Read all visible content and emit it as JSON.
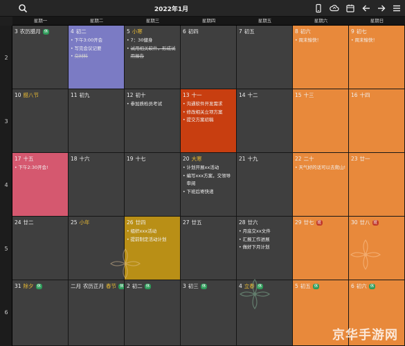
{
  "toolbar": {
    "title": "2022年1月",
    "icons": [
      "search-icon",
      "phone-icon",
      "cloud-sync-icon",
      "calendar-icon",
      "back-arrow-icon",
      "forward-arrow-icon",
      "menu-icon"
    ]
  },
  "weekdays": [
    "星期一",
    "星期二",
    "星期三",
    "星期四",
    "星期五",
    "星期六",
    "星期日"
  ],
  "week_numbers": [
    "2",
    "3",
    "4",
    "5",
    "6"
  ],
  "weeks": [
    [
      {
        "day": "3",
        "lunar": "农历腊月",
        "badge": "休",
        "badge_type": "work",
        "color": "dim",
        "events": []
      },
      {
        "day": "4",
        "lunar": "初二",
        "color": "purple",
        "events": [
          {
            "text": "下午3:00开会",
            "done": false
          },
          {
            "text": "写完会议记要",
            "done": false
          },
          {
            "text": "交材料",
            "done": true
          }
        ]
      },
      {
        "day": "5",
        "lunar": "小寒",
        "term": true,
        "color": "dim",
        "events": [
          {
            "text": "7：30健身",
            "done": false
          },
          {
            "text": "试用相关软件，形成试用报告",
            "done": true
          }
        ]
      },
      {
        "day": "6",
        "lunar": "初四",
        "color": "dim",
        "events": []
      },
      {
        "day": "7",
        "lunar": "初五",
        "color": "dim",
        "events": []
      },
      {
        "day": "8",
        "lunar": "初六",
        "color": "orange",
        "events": [
          {
            "text": "周末愉快！",
            "done": false
          }
        ]
      },
      {
        "day": "9",
        "lunar": "初七",
        "color": "orange",
        "events": [
          {
            "text": "周末愉快！",
            "done": false
          }
        ]
      }
    ],
    [
      {
        "day": "10",
        "lunar": "腊八节",
        "term": true,
        "color": "dim",
        "events": []
      },
      {
        "day": "11",
        "lunar": "初九",
        "color": "dim",
        "events": []
      },
      {
        "day": "12",
        "lunar": "初十",
        "color": "dim",
        "events": [
          {
            "text": "参加质检员考试",
            "done": false
          }
        ]
      },
      {
        "day": "13",
        "lunar": "十一",
        "color": "red",
        "events": [
          {
            "text": "沟通软件开发需求",
            "done": false
          },
          {
            "text": "修改相关立项方案",
            "done": false
          },
          {
            "text": "提交方案初稿",
            "done": false
          }
        ]
      },
      {
        "day": "14",
        "lunar": "十二",
        "color": "dim",
        "events": []
      },
      {
        "day": "15",
        "lunar": "十三",
        "color": "orange",
        "events": []
      },
      {
        "day": "16",
        "lunar": "十四",
        "color": "orange",
        "events": []
      }
    ],
    [
      {
        "day": "17",
        "lunar": "十五",
        "color": "pink",
        "events": [
          {
            "text": "下午2:30开会!",
            "done": false
          }
        ]
      },
      {
        "day": "18",
        "lunar": "十六",
        "color": "dim",
        "events": []
      },
      {
        "day": "19",
        "lunar": "十七",
        "color": "dim",
        "events": []
      },
      {
        "day": "20",
        "lunar": "大寒",
        "term": true,
        "color": "dim",
        "events": [
          {
            "text": "计划开展xx活动",
            "done": false
          },
          {
            "text": "编写xxx方案，交领导审阅",
            "done": false
          },
          {
            "text": "下班后寄快递",
            "done": false
          }
        ]
      },
      {
        "day": "21",
        "lunar": "十九",
        "color": "dim",
        "events": []
      },
      {
        "day": "22",
        "lunar": "二十",
        "color": "orange",
        "events": [
          {
            "text": "天气好的话可以去爬山!",
            "done": false
          }
        ]
      },
      {
        "day": "23",
        "lunar": "廿一",
        "color": "orange",
        "events": []
      }
    ],
    [
      {
        "day": "24",
        "lunar": "廿二",
        "color": "dim",
        "events": []
      },
      {
        "day": "25",
        "lunar": "小年",
        "term": true,
        "color": "dim",
        "events": []
      },
      {
        "day": "26",
        "lunar": "廿四",
        "color": "yellow",
        "events": [
          {
            "text": "组织xxx活动",
            "done": false
          },
          {
            "text": "提前制定活动计划",
            "done": false
          }
        ]
      },
      {
        "day": "27",
        "lunar": "廿五",
        "color": "dim",
        "events": []
      },
      {
        "day": "28",
        "lunar": "廿六",
        "color": "dim",
        "events": [
          {
            "text": "月底交xx文件",
            "done": false
          },
          {
            "text": "汇报工作进展",
            "done": false
          },
          {
            "text": "做好下月计划",
            "done": false
          }
        ]
      },
      {
        "day": "29",
        "lunar": "廿七",
        "badge": "班",
        "badge_type": "rest",
        "color": "orange",
        "events": []
      },
      {
        "day": "30",
        "lunar": "廿八",
        "badge": "班",
        "badge_type": "rest",
        "color": "orange",
        "events": []
      }
    ],
    [
      {
        "day": "31",
        "lunar": "除夕",
        "term": true,
        "badge": "休",
        "badge_type": "work",
        "color": "dim",
        "events": []
      },
      {
        "day": "二月",
        "lunar": "农历正月",
        "color": "dim",
        "events": [],
        "extra": "春节",
        "extra_badge": "休"
      },
      {
        "day": "2",
        "lunar": "初二",
        "badge": "休",
        "badge_type": "work",
        "color": "dim",
        "events": []
      },
      {
        "day": "3",
        "lunar": "初三",
        "badge": "休",
        "badge_type": "work",
        "color": "dim",
        "events": []
      },
      {
        "day": "4",
        "lunar": "立春",
        "term": true,
        "badge": "休",
        "badge_type": "work",
        "color": "dim",
        "events": []
      },
      {
        "day": "5",
        "lunar": "初五",
        "badge": "休",
        "badge_type": "work",
        "color": "orange",
        "events": []
      },
      {
        "day": "6",
        "lunar": "初六",
        "badge": "休",
        "badge_type": "work",
        "color": "orange",
        "events": []
      }
    ]
  ],
  "watermark": "京华手游网"
}
